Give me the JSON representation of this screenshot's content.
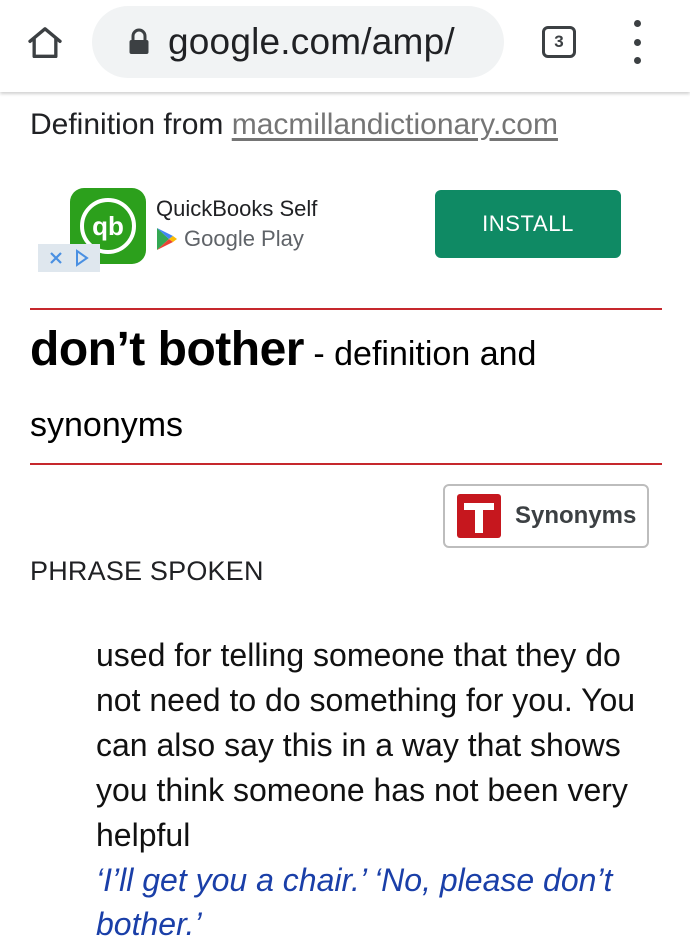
{
  "browser": {
    "url": "google.com/amp/",
    "tab_count": "3",
    "icons": {
      "home": "home-icon",
      "lock": "lock-icon",
      "menu": "more-vert-icon"
    }
  },
  "source": {
    "prefix": "Definition from ",
    "link_text": "macmillandictionary.com"
  },
  "ad": {
    "app_name": "QuickBooks Self",
    "store_name": "Google Play",
    "install_label": "INSTALL",
    "logo_text": "qb",
    "colors": {
      "logo": "#2ca01c",
      "install": "#0f8a64"
    }
  },
  "entry": {
    "headword": "don’t bother",
    "suffix": " - definition and synonyms",
    "synonyms_button": "Synonyms",
    "part_of_speech": "PHRASE SPOKEN",
    "definition": "used for telling someone that they do not need to do something for you. You can also say this in a way that shows you think someone has not been very helpful",
    "example": "‘I’ll get you a chair.’ ‘No, please don’t bother.’"
  },
  "colors": {
    "rule": "#c6282d",
    "example_text": "#1a3fa8",
    "synonyms_icon": "#c6171e"
  }
}
